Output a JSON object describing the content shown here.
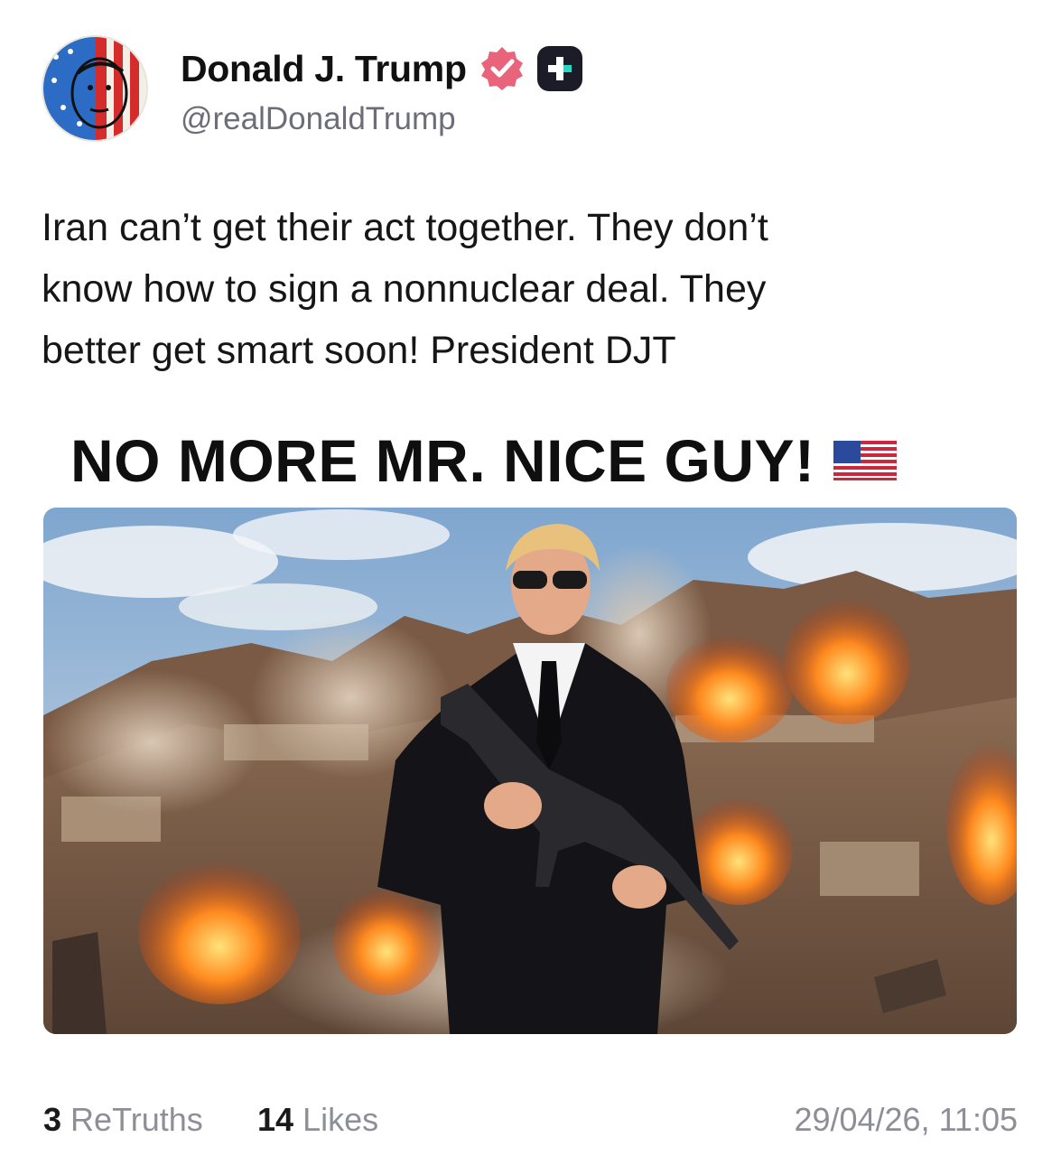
{
  "author": {
    "display_name": "Donald J. Trump",
    "handle": "@realDonaldTrump",
    "avatar_icon": "flag-portrait-avatar",
    "verified_icon": "verified-badge-icon",
    "verified_color": "#e9637a",
    "platform_badge_icon": "truth-social-plus-icon"
  },
  "post": {
    "text": "Iran can’t get their act together. They don’t\nknow how to sign a nonnuclear deal. They\nbetter get smart soon! President DJT"
  },
  "media": {
    "headline": "NO MORE MR. NICE GUY!",
    "flag_icon": "us-flag-emoji",
    "image_icon": "battle-scene-image"
  },
  "stats": {
    "retruths_count": "3",
    "retruths_label": "ReTruths",
    "likes_count": "14",
    "likes_label": "Likes",
    "timestamp": "29/04/26, 11:05"
  }
}
